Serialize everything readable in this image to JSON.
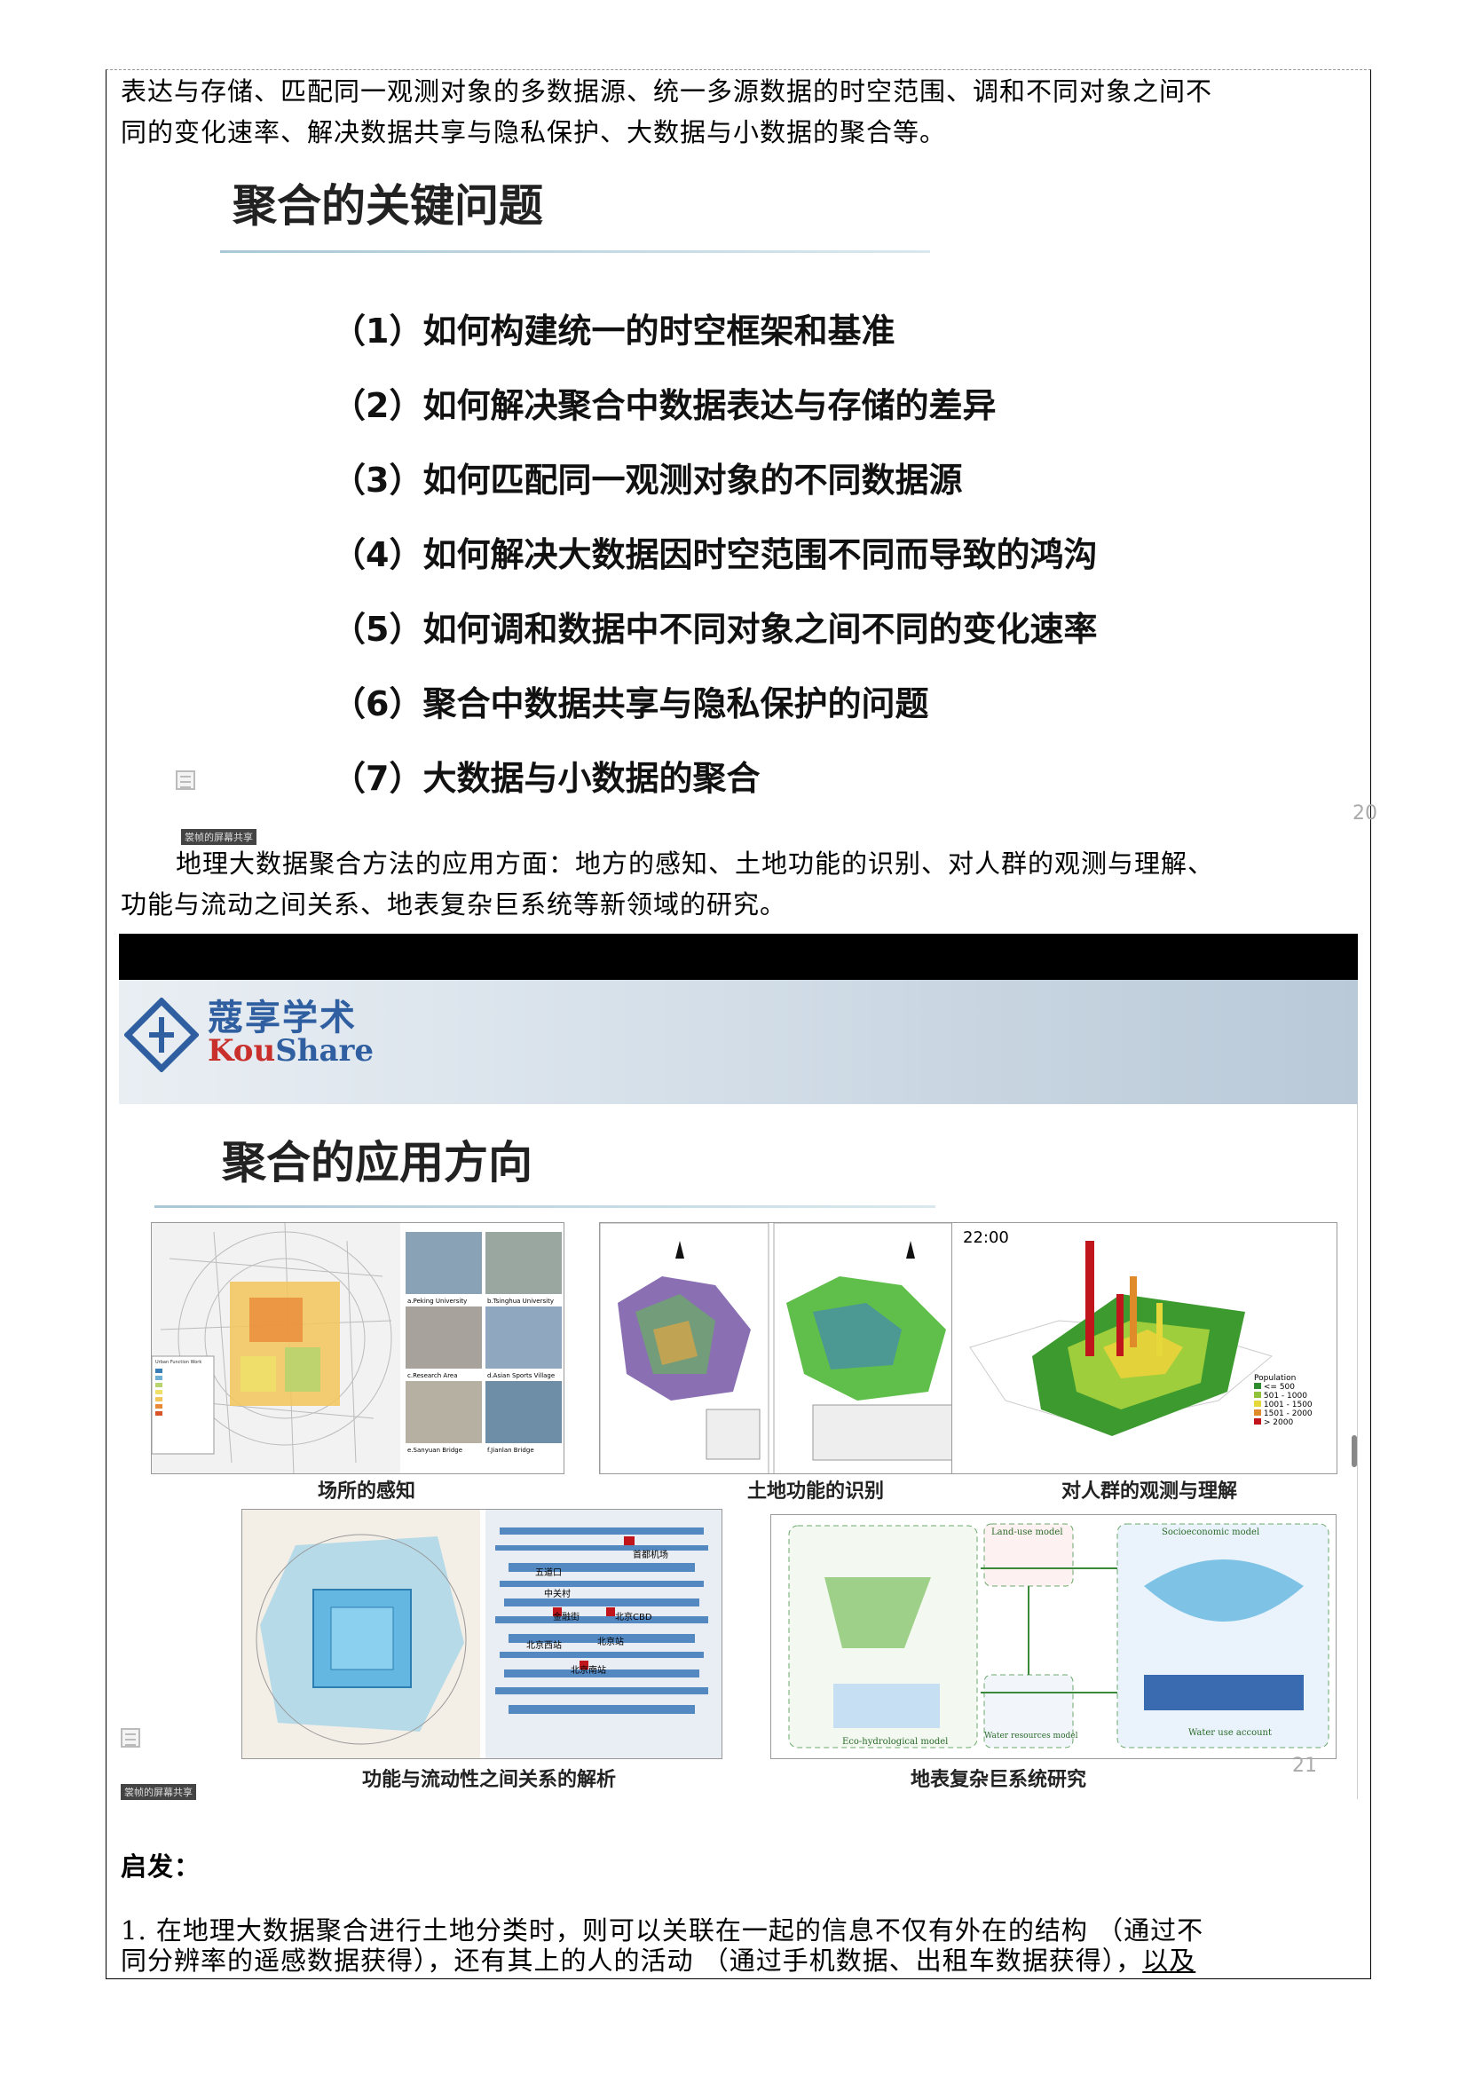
{
  "top_paragraph": {
    "line1": "表达与存储、匹配同一观测对象的多数据源、统一多源数据的时空范围、调和不同对象之间不",
    "line2": "同的变化速率、解决数据共享与隐私保护、大数据与小数据的聚合等。"
  },
  "slide1": {
    "title": "聚合的关键问题",
    "items": [
      "（1）如何构建统一的时空框架和基准",
      "（2）如何解决聚合中数据表达与存储的差异",
      "（3）如何匹配同一观测对象的不同数据源",
      "（4）如何解决大数据因时空范围不同而导致的鸿沟",
      "（5）如何调和数据中不同对象之间不同的变化速率",
      "（6）聚合中数据共享与隐私保护的问题",
      "（7）大数据与小数据的聚合"
    ],
    "share_tag": "裳帧的屏幕共享",
    "page_number": "20"
  },
  "middle_paragraph": {
    "line1": "地理大数据聚合方法的应用方面：地方的感知、土地功能的识别、对人群的观测与理解、",
    "line2": "功能与流动之间关系、地表复杂巨系统等新领域的研究。"
  },
  "slide2": {
    "logo_cn": "蔻享学术",
    "logo_en_red": "Kou",
    "logo_en_blue": "Share",
    "title": "聚合的应用方向",
    "captions": {
      "place": "场所的感知",
      "land": "土地功能的识别",
      "crowd": "对人群的观测与理解",
      "flow": "功能与流动性之间关系的解析",
      "earth": "地表复杂巨系统研究"
    },
    "panel_time": "22:00",
    "population_legend": {
      "title": "Population",
      "items": [
        "<= 500",
        "501 - 1000",
        "1001 - 1500",
        "1501 - 2000",
        "> 2000"
      ],
      "colors": [
        "#2e8b2e",
        "#8fc13b",
        "#e6d83a",
        "#e08b2a",
        "#c0161b"
      ]
    },
    "photo_labels": [
      "a.Peking University",
      "b.Tsinghua University",
      "c.Research Area",
      "d.Asian Sports Village",
      "e.Sanyuan Bridge",
      "f.Jianlan Bridge"
    ],
    "flow_labels": [
      "五道口",
      "中关村",
      "金融街",
      "北京西站",
      "北京南站",
      "北京CBD",
      "北京站",
      "首都机场"
    ],
    "model_labels": [
      "Land-use model",
      "Socioeconomic model",
      "Water resources model",
      "Water use account",
      "Eco-hydrological model"
    ],
    "share_tag": "裳帧的屏幕共享",
    "page_number": "21"
  },
  "bottom": {
    "heading": "启发：",
    "line1": "1.  在地理大数据聚合进行土地分类时，则可以关联在一起的信息不仅有外在的结构 （通过不",
    "line2_a": "同分辨率的遥感数据获得），还有其上的人的活动 （通过手机数据、出租车数据获得），",
    "line2_b": "以及"
  }
}
